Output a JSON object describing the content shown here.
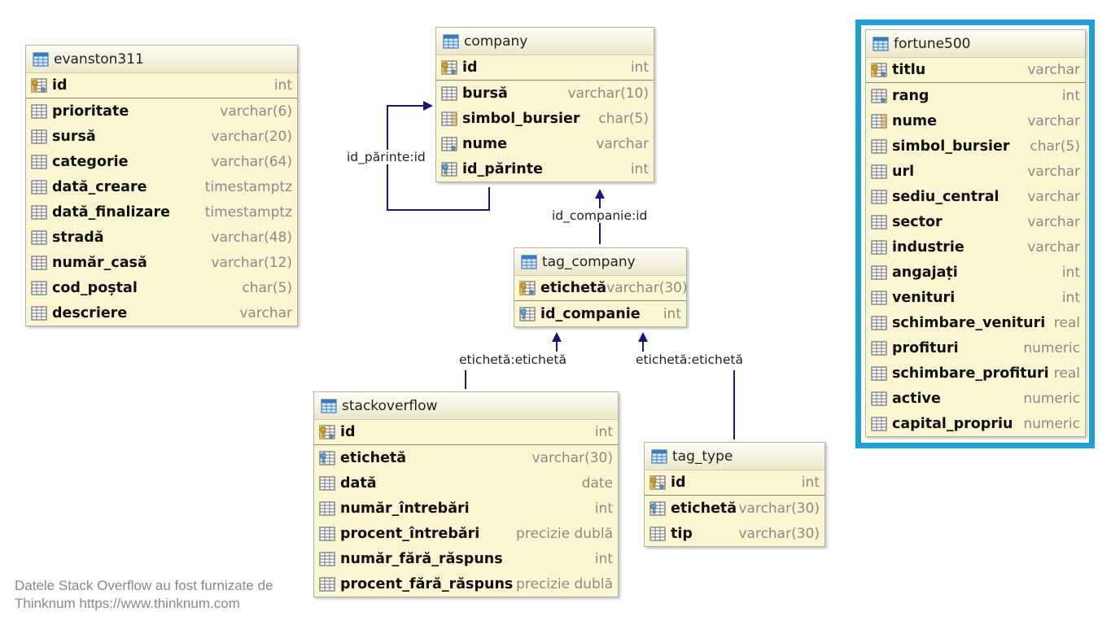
{
  "tables": {
    "evanston311": {
      "name": "evanston311",
      "columns": [
        {
          "name": "id",
          "type": "int",
          "key": "pk"
        },
        {
          "name": "prioritate",
          "type": "varchar(6)",
          "key": ""
        },
        {
          "name": "sursă",
          "type": "varchar(20)",
          "key": ""
        },
        {
          "name": "categorie",
          "type": "varchar(64)",
          "key": ""
        },
        {
          "name": "dată_creare",
          "type": "timestamptz",
          "key": ""
        },
        {
          "name": "dată_finalizare",
          "type": "timestamptz",
          "key": ""
        },
        {
          "name": "stradă",
          "type": "varchar(48)",
          "key": ""
        },
        {
          "name": "număr_casă",
          "type": "varchar(12)",
          "key": ""
        },
        {
          "name": "cod_poștal",
          "type": "char(5)",
          "key": ""
        },
        {
          "name": "descriere",
          "type": "varchar",
          "key": ""
        }
      ]
    },
    "company": {
      "name": "company",
      "columns": [
        {
          "name": "id",
          "type": "int",
          "key": "pk"
        },
        {
          "name": "bursă",
          "type": "varchar(10)",
          "key": ""
        },
        {
          "name": "simbol_bursier",
          "type": "char(5)",
          "key": "uq"
        },
        {
          "name": "nume",
          "type": "varchar",
          "key": "nn"
        },
        {
          "name": "id_părinte",
          "type": "int",
          "key": "fk"
        }
      ]
    },
    "tag_company": {
      "name": "tag_company",
      "columns": [
        {
          "name": "etichetă",
          "type": "varchar(30)",
          "key": "pk"
        },
        {
          "name": "id_companie",
          "type": "int",
          "key": "fk"
        }
      ]
    },
    "stackoverflow": {
      "name": "stackoverflow",
      "columns": [
        {
          "name": "id",
          "type": "int",
          "key": "pk"
        },
        {
          "name": "etichetă",
          "type": "varchar(30)",
          "key": "fk"
        },
        {
          "name": "dată",
          "type": "date",
          "key": ""
        },
        {
          "name": "număr_întrebări",
          "type": "int",
          "key": ""
        },
        {
          "name": "procent_întrebări",
          "type": "precizie dublă",
          "key": ""
        },
        {
          "name": "număr_fără_răspuns",
          "type": "int",
          "key": ""
        },
        {
          "name": "procent_fără_răspuns",
          "type": "precizie dublă",
          "key": ""
        }
      ]
    },
    "tag_type": {
      "name": "tag_type",
      "columns": [
        {
          "name": "id",
          "type": "int",
          "key": "pk"
        },
        {
          "name": "etichetă",
          "type": "varchar(30)",
          "key": "fk"
        },
        {
          "name": "tip",
          "type": "varchar(30)",
          "key": ""
        }
      ]
    },
    "fortune500": {
      "name": "fortune500",
      "columns": [
        {
          "name": "titlu",
          "type": "varchar",
          "key": "pk"
        },
        {
          "name": "rang",
          "type": "int",
          "key": "nn"
        },
        {
          "name": "nume",
          "type": "varchar",
          "key": "uq"
        },
        {
          "name": "simbol_bursier",
          "type": "char(5)",
          "key": ""
        },
        {
          "name": "url",
          "type": "varchar",
          "key": ""
        },
        {
          "name": "sediu_central",
          "type": "varchar",
          "key": ""
        },
        {
          "name": "sector",
          "type": "varchar",
          "key": ""
        },
        {
          "name": "industrie",
          "type": "varchar",
          "key": ""
        },
        {
          "name": "angajați",
          "type": "int",
          "key": ""
        },
        {
          "name": "venituri",
          "type": "int",
          "key": ""
        },
        {
          "name": "schimbare_venituri",
          "type": "real",
          "key": ""
        },
        {
          "name": "profituri",
          "type": "numeric",
          "key": ""
        },
        {
          "name": "schimbare_profituri",
          "type": "real",
          "key": ""
        },
        {
          "name": "active",
          "type": "numeric",
          "key": ""
        },
        {
          "name": "capital_propriu",
          "type": "numeric",
          "key": ""
        }
      ]
    }
  },
  "relationships": {
    "company_self": "id_părinte:id",
    "tag_company_company": "id_companie:id",
    "stackoverflow_tag": "etichetă:etichetă",
    "tag_type_tag": "etichetă:etichetă"
  },
  "credit": {
    "line1": "Datele Stack Overflow au fost furnizate de",
    "line2": "Thinknum https://www.thinknum.com"
  },
  "colors": {
    "highlight": "#1e9fd6",
    "link": "#1a1a7a",
    "table_bg": "#fbf6d2"
  }
}
